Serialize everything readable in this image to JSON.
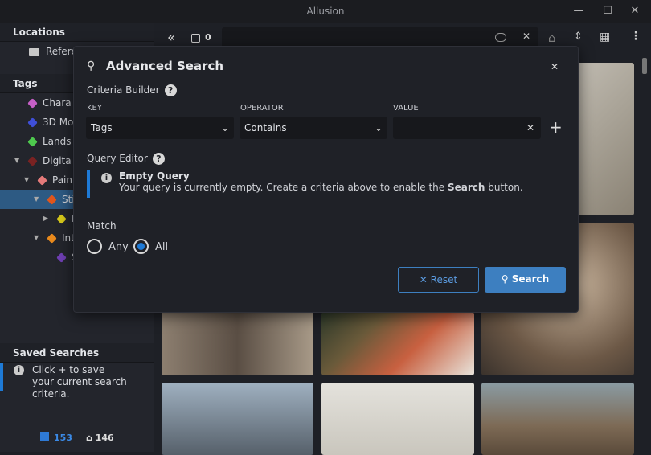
{
  "window": {
    "title": "Allusion",
    "minimize": "—",
    "maximize": "☐",
    "close": "✕"
  },
  "sidebar": {
    "locations_title": "Locations",
    "locations": [
      {
        "label": "Refere"
      }
    ],
    "tags_title": "Tags",
    "tags": [
      {
        "label": "Chara",
        "color": "#c65fc6"
      },
      {
        "label": "3D Mo",
        "color": "#3f4fd8"
      },
      {
        "label": "Lands",
        "color": "#4ec94e"
      },
      {
        "label": "Digita",
        "color": "#7a2222"
      },
      {
        "label": "Paint",
        "color": "#e57a7a"
      },
      {
        "label": "Stil",
        "color": "#e0561c",
        "selected": true
      },
      {
        "label": "Fu",
        "color": "#d6c81a"
      },
      {
        "label": "Inte",
        "color": "#e8891c"
      },
      {
        "label": "Sk",
        "color": "#6f3fb3"
      }
    ],
    "saved_title": "Saved Searches",
    "saved_hint": "Click + to save your current search criteria.",
    "image_count": "153",
    "tag_count": "146"
  },
  "toolbar": {
    "selected_count": "0"
  },
  "dialog": {
    "title": "Advanced Search",
    "criteria_label": "Criteria Builder",
    "key_header": "KEY",
    "operator_header": "OPERATOR",
    "value_header": "VALUE",
    "key_value": "Tags",
    "operator_value": "Contains",
    "value_value": "",
    "query_label": "Query Editor",
    "empty_title": "Empty Query",
    "empty_text_1": "Your query is currently empty. Create a criteria above to enable the ",
    "empty_text_bold": "Search",
    "empty_text_2": " button.",
    "match_label": "Match",
    "any_label": "Any",
    "all_label": "All",
    "match_value": "All",
    "reset_label": "Reset",
    "search_label": "Search",
    "accent": "#3d7fc0"
  }
}
